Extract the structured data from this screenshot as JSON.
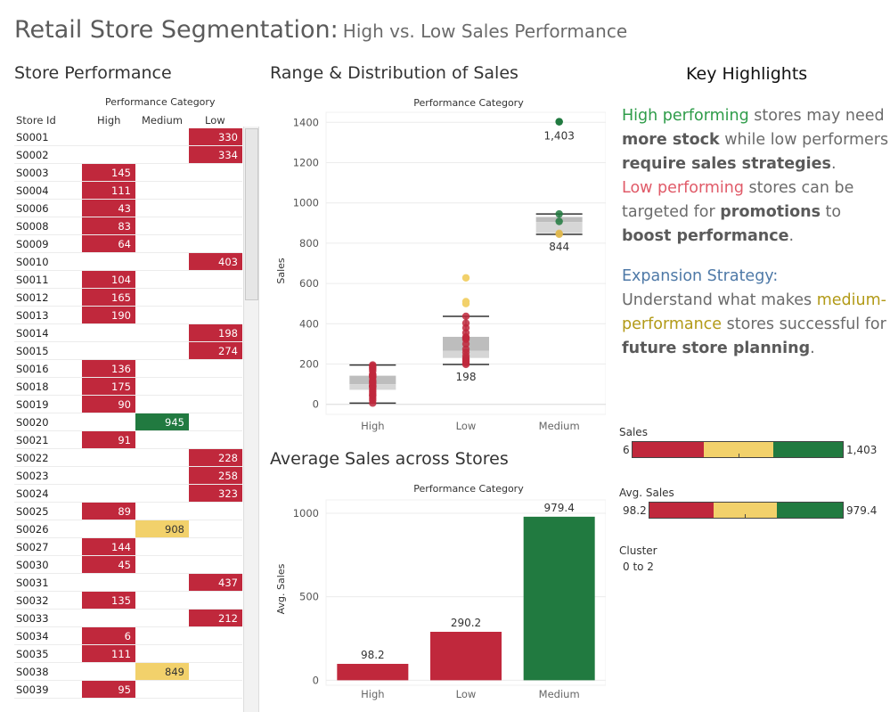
{
  "title": {
    "main": "Retail Store Segmentation:",
    "sub": "High vs. Low Sales Performance"
  },
  "table_panel": {
    "title": "Store Performance",
    "category_header": "Performance Category",
    "col_store": "Store Id",
    "columns": [
      "High",
      "Medium",
      "Low"
    ],
    "rows": [
      {
        "id": "S0001",
        "cat": "Low",
        "value": "330"
      },
      {
        "id": "S0002",
        "cat": "Low",
        "value": "334"
      },
      {
        "id": "S0003",
        "cat": "High",
        "value": "145"
      },
      {
        "id": "S0004",
        "cat": "High",
        "value": "111"
      },
      {
        "id": "S0006",
        "cat": "High",
        "value": "43"
      },
      {
        "id": "S0008",
        "cat": "High",
        "value": "83"
      },
      {
        "id": "S0009",
        "cat": "High",
        "value": "64"
      },
      {
        "id": "S0010",
        "cat": "Low",
        "value": "403"
      },
      {
        "id": "S0011",
        "cat": "High",
        "value": "104"
      },
      {
        "id": "S0012",
        "cat": "High",
        "value": "165"
      },
      {
        "id": "S0013",
        "cat": "High",
        "value": "190"
      },
      {
        "id": "S0014",
        "cat": "Low",
        "value": "198"
      },
      {
        "id": "S0015",
        "cat": "Low",
        "value": "274"
      },
      {
        "id": "S0016",
        "cat": "High",
        "value": "136"
      },
      {
        "id": "S0018",
        "cat": "High",
        "value": "175"
      },
      {
        "id": "S0019",
        "cat": "High",
        "value": "90"
      },
      {
        "id": "S0020",
        "cat": "Medium",
        "value": "945",
        "color": "#217a40"
      },
      {
        "id": "S0021",
        "cat": "High",
        "value": "91"
      },
      {
        "id": "S0022",
        "cat": "Low",
        "value": "228"
      },
      {
        "id": "S0023",
        "cat": "Low",
        "value": "258"
      },
      {
        "id": "S0024",
        "cat": "Low",
        "value": "323"
      },
      {
        "id": "S0025",
        "cat": "High",
        "value": "89"
      },
      {
        "id": "S0026",
        "cat": "Medium",
        "value": "908",
        "color": "#f2d16b"
      },
      {
        "id": "S0027",
        "cat": "High",
        "value": "144"
      },
      {
        "id": "S0030",
        "cat": "High",
        "value": "45"
      },
      {
        "id": "S0031",
        "cat": "Low",
        "value": "437"
      },
      {
        "id": "S0032",
        "cat": "High",
        "value": "135"
      },
      {
        "id": "S0033",
        "cat": "Low",
        "value": "212"
      },
      {
        "id": "S0034",
        "cat": "High",
        "value": "6"
      },
      {
        "id": "S0035",
        "cat": "High",
        "value": "111"
      },
      {
        "id": "S0038",
        "cat": "Medium",
        "value": "849",
        "color": "#f2d16b"
      },
      {
        "id": "S0039",
        "cat": "High",
        "value": "95"
      }
    ]
  },
  "colors": {
    "red": "#c0283c",
    "yellow": "#f2d16b",
    "green": "#217a40",
    "medium_gold": "#e0b94e"
  },
  "chart_data": [
    {
      "type": "scatter",
      "title": "Range & Distribution of Sales",
      "header": "Performance Category",
      "ylabel": "Sales",
      "ylim": [
        -50,
        1450
      ],
      "yticks": [
        0,
        200,
        400,
        600,
        800,
        1000,
        1200,
        1400
      ],
      "categories": [
        "High",
        "Low",
        "Medium"
      ],
      "boxes": [
        {
          "category": "High",
          "min": 6,
          "q1": 72,
          "median": 100,
          "q3": 142,
          "max": 195
        },
        {
          "category": "Low",
          "min": 198,
          "q1": 230,
          "median": 265,
          "q3": 335,
          "max": 437
        },
        {
          "category": "Medium",
          "min": 844,
          "q1": 850,
          "median": 905,
          "q3": 930,
          "max": 945
        }
      ],
      "points": [
        {
          "category": "High",
          "values": [
            6,
            20,
            30,
            43,
            45,
            55,
            64,
            72,
            83,
            89,
            90,
            91,
            95,
            104,
            111,
            111,
            120,
            135,
            136,
            144,
            145,
            150,
            165,
            175,
            182,
            190,
            195
          ]
        },
        {
          "category": "Low",
          "values": [
            198,
            205,
            212,
            220,
            228,
            240,
            258,
            274,
            300,
            323,
            330,
            334,
            355,
            380,
            403,
            437
          ]
        },
        {
          "category": "Medium",
          "values": [
            844,
            849,
            908,
            945,
            1403
          ]
        }
      ],
      "outliers": [
        {
          "category": "Low",
          "value": 500,
          "color": "#f2d16b"
        },
        {
          "category": "Low",
          "value": 510,
          "color": "#f2d16b"
        },
        {
          "category": "Low",
          "value": 628,
          "color": "#f2d16b"
        },
        {
          "category": "Medium",
          "value": 1403,
          "color": "#217a40"
        }
      ],
      "labels": [
        {
          "category": "Medium",
          "value": 1403,
          "text": "1,403"
        },
        {
          "category": "Medium",
          "value": 844,
          "text": "844"
        },
        {
          "category": "Low",
          "value": 198,
          "text": "198"
        }
      ]
    },
    {
      "type": "bar",
      "title": "Average Sales across Stores",
      "header": "Performance Category",
      "ylabel": "Avg. Sales",
      "ylim": [
        -30,
        1080
      ],
      "yticks": [
        0,
        500,
        1000
      ],
      "categories": [
        "High",
        "Low",
        "Medium"
      ],
      "values": [
        98.2,
        290.2,
        979.4
      ],
      "value_labels": [
        "98.2",
        "290.2",
        "979.4"
      ],
      "bar_colors": [
        "#c0283c",
        "#c0283c",
        "#217a40"
      ]
    }
  ],
  "highlights": {
    "title": "Key Highlights",
    "p1": {
      "a": "High performing",
      "b": " stores may need ",
      "c": "more stock",
      "d": " while low performers ",
      "e": "require sales strategies",
      "f": ".",
      "g": "Low performing",
      "h": " stores can be targeted for ",
      "i": "promotions",
      "j": " to ",
      "k": "boost performance",
      "l": "."
    },
    "p2": {
      "a": "Expansion Strategy:",
      "b": "Understand what makes ",
      "c": "medium-performance",
      "d": " stores successful for ",
      "e": "future store planning",
      "f": "."
    }
  },
  "legends": {
    "sales": {
      "label": "Sales",
      "min": "6",
      "max": "1,403"
    },
    "avg_sales": {
      "label": "Avg. Sales",
      "min": "98.2",
      "max": "979.4"
    },
    "cluster": {
      "label": "Cluster",
      "range": "0 to 2"
    }
  }
}
